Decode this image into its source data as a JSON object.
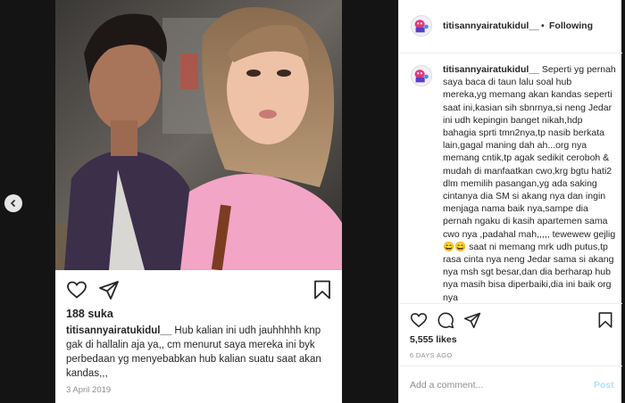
{
  "embedded_post": {
    "likes": "188 suka",
    "caption_user": "titisannyairatukidul__",
    "caption_text": " Hub kalian ini udh jauhhhhh knp gak di hallalin aja ya,, cm menurut saya mereka ini byk perbedaan yg menyebabkan hub kalian suatu saat akan kandas,,,",
    "date": "3 April 2019"
  },
  "panel": {
    "username": "titisannyairatukidul__",
    "separator": "•",
    "follow_label": "Following",
    "comment_user": "titisannyairatukidul__",
    "comment_text": " Seperti yg pernah saya baca di taun lalu soal hub mereka,yg memang akan kandas seperti saat ini,kasian sih sbnrnya,si neng Jedar ini udh kepingin banget nikah,hdp bahagia sprti tmn2nya,tp nasib berkata lain,gagal maning dah ah...org nya memang cntik,tp agak sedikit ceroboh & mudah di manfaatkan cwo,krg bgtu hati2 dlm memilih pasangan,yg ada saking cintanya dia SM si akang nya dan ingin menjaga nama baik nya,sampe dia pernah ngaku di kasih apartemen sama cwo nya ,padahal mah,,,,, tewewew gejlig😄😄 saat ni memang mrk udh putus,tp rasa cinta nya neng Jedar sama si akang nya msh sgt besar,dan dia berharap hub nya masih bisa diperbaiki,dia ini baik org nya",
    "likes": "5,555 likes",
    "time_ago": "6 DAYS AGO",
    "comment_placeholder": "Add a comment...",
    "post_label": "Post"
  },
  "icons": {
    "prev": "chevron-left-icon",
    "like": "heart-icon",
    "comment": "comment-icon",
    "share": "paper-plane-icon",
    "save": "bookmark-icon"
  }
}
